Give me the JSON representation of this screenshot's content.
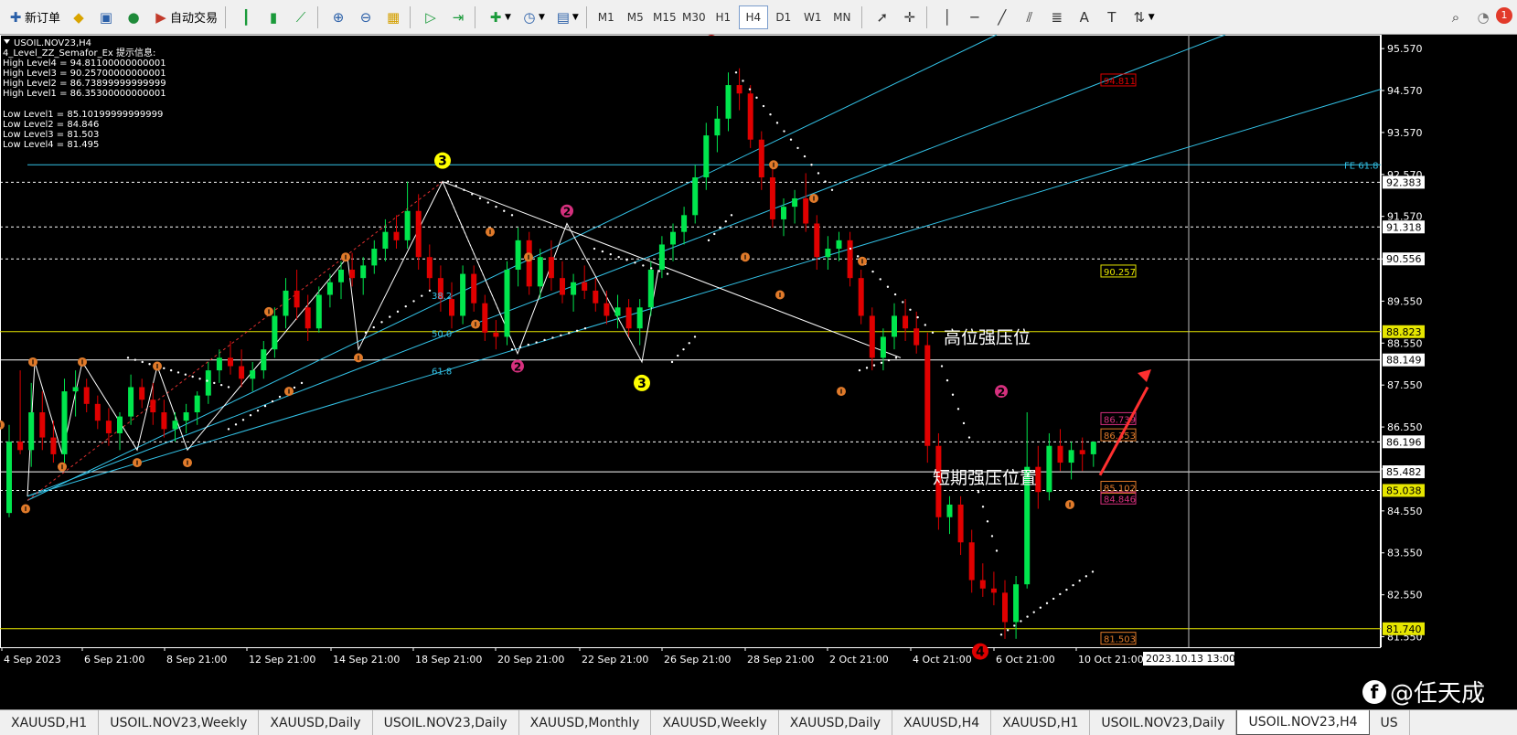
{
  "toolbar": {
    "new_order": "新订单",
    "auto_trading": "自动交易",
    "timeframes": [
      "M1",
      "M5",
      "M15",
      "M30",
      "H1",
      "H4",
      "D1",
      "W1",
      "MN"
    ],
    "active_timeframe": "H4",
    "alert_count": "1"
  },
  "info_panel": {
    "symbol_line": "USOIL.NOV23,H4",
    "indicator_line": "4_Level_ZZ_Semafor_Ex 提示信息:",
    "high_levels": [
      "High Level4 = 94.81100000000001",
      "High Level3 = 90.25700000000001",
      "High Level2 = 86.73899999999999",
      "High Level1 = 86.35300000000001"
    ],
    "low_levels": [
      "Low Level1 = 85.10199999999999",
      "Low Level2 = 84.846",
      "Low Level3 = 81.503",
      "Low Level4 = 81.495"
    ]
  },
  "price_axis": {
    "ticks": [
      "95.570",
      "94.570",
      "93.570",
      "92.570",
      "91.570",
      "90.556",
      "89.550",
      "88.550",
      "87.550",
      "86.550",
      "85.550",
      "84.550",
      "83.550",
      "82.550",
      "81.550"
    ],
    "line_labels": [
      "92.383",
      "91.318",
      "90.556",
      "88.823",
      "88.149",
      "86.196",
      "85.482",
      "85.038",
      "81.740"
    ]
  },
  "time_axis": {
    "ticks": [
      "4 Sep 2023",
      "6 Sep 21:00",
      "8 Sep 21:00",
      "12 Sep 21:00",
      "14 Sep 21:00",
      "18 Sep 21:00",
      "20 Sep 21:00",
      "22 Sep 21:00",
      "26 Sep 21:00",
      "28 Sep 21:00",
      "2 Oct 21:00",
      "4 Oct 21:00",
      "6 Oct 21:00",
      "10 Oct 21:00"
    ],
    "crosshair_time": "2023.10.13 13:00"
  },
  "chart_annotations": {
    "fe_label": "FE 61.8",
    "fib_labels": [
      "38.2",
      "50.0",
      "61.8"
    ],
    "level_boxes": [
      "94.811",
      "90.257",
      "86.739",
      "86.353",
      "85.102",
      "84.846",
      "81.503"
    ],
    "high_resistance": "高位强压位",
    "short_resistance": "短期强压位置"
  },
  "semafor_marks": [
    "4",
    "3",
    "2",
    "2",
    "3",
    "2",
    "4"
  ],
  "tabs": [
    "XAUUSD,H1",
    "USOIL.NOV23,Weekly",
    "XAUUSD,Daily",
    "USOIL.NOV23,Daily",
    "XAUUSD,Monthly",
    "XAUUSD,Weekly",
    "XAUUSD,Daily",
    "XAUUSD,H4",
    "XAUUSD,H1",
    "USOIL.NOV23,Daily",
    "USOIL.NOV23,H4",
    "US"
  ],
  "active_tab": "USOIL.NOV23,H4",
  "watermark": "@任天成",
  "colors": {
    "bull": "#00e64d",
    "bear": "#e00000",
    "axis": "#ffffff",
    "trend": "#33c3e8",
    "level": "#e6e600"
  },
  "chart_data": {
    "type": "candlestick",
    "symbol": "USOIL.NOV23",
    "timeframe": "H4",
    "ylim": [
      81.3,
      95.9
    ],
    "candles": [
      [
        84.5,
        86.6,
        84.4,
        86.2
      ],
      [
        86.2,
        87.9,
        85.9,
        86.0
      ],
      [
        86.0,
        87.6,
        85.6,
        86.9
      ],
      [
        86.9,
        87.4,
        86.0,
        86.3
      ],
      [
        86.3,
        86.7,
        85.7,
        85.9
      ],
      [
        85.9,
        87.7,
        85.7,
        87.4
      ],
      [
        87.4,
        87.9,
        86.8,
        87.5
      ],
      [
        87.5,
        87.7,
        86.9,
        87.1
      ],
      [
        87.1,
        87.3,
        86.5,
        86.7
      ],
      [
        86.7,
        87.0,
        86.1,
        86.4
      ],
      [
        86.4,
        86.9,
        86.0,
        86.8
      ],
      [
        86.8,
        87.8,
        86.6,
        87.5
      ],
      [
        87.5,
        87.7,
        87.0,
        87.2
      ],
      [
        87.2,
        87.6,
        86.6,
        86.9
      ],
      [
        86.9,
        87.2,
        86.3,
        86.5
      ],
      [
        86.5,
        86.9,
        86.2,
        86.7
      ],
      [
        86.7,
        87.1,
        86.4,
        86.9
      ],
      [
        86.9,
        87.4,
        86.6,
        87.3
      ],
      [
        87.3,
        88.1,
        87.1,
        87.9
      ],
      [
        87.9,
        88.4,
        87.6,
        88.2
      ],
      [
        88.2,
        88.6,
        87.8,
        88.0
      ],
      [
        88.0,
        88.4,
        87.5,
        87.7
      ],
      [
        87.7,
        88.1,
        87.4,
        87.9
      ],
      [
        87.9,
        88.6,
        87.7,
        88.4
      ],
      [
        88.4,
        89.4,
        88.2,
        89.2
      ],
      [
        89.2,
        90.1,
        88.9,
        89.8
      ],
      [
        89.8,
        90.3,
        89.1,
        89.4
      ],
      [
        89.4,
        89.7,
        88.6,
        88.9
      ],
      [
        88.9,
        89.9,
        88.8,
        89.7
      ],
      [
        89.7,
        90.2,
        89.4,
        90.0
      ],
      [
        90.0,
        90.5,
        89.6,
        90.3
      ],
      [
        90.3,
        90.7,
        89.9,
        90.1
      ],
      [
        90.1,
        90.6,
        89.7,
        90.4
      ],
      [
        90.4,
        91.0,
        90.2,
        90.8
      ],
      [
        90.8,
        91.5,
        90.5,
        91.2
      ],
      [
        91.2,
        91.6,
        90.8,
        91.0
      ],
      [
        91.0,
        92.4,
        90.8,
        91.7
      ],
      [
        91.7,
        92.1,
        90.3,
        90.6
      ],
      [
        90.6,
        90.9,
        89.8,
        90.1
      ],
      [
        90.1,
        90.4,
        89.3,
        89.6
      ],
      [
        89.6,
        90.0,
        88.9,
        89.2
      ],
      [
        89.2,
        90.4,
        89.0,
        90.2
      ],
      [
        90.2,
        90.4,
        89.3,
        89.5
      ],
      [
        89.5,
        89.7,
        88.6,
        88.8
      ],
      [
        88.8,
        89.1,
        88.4,
        88.7
      ],
      [
        88.7,
        90.5,
        88.5,
        90.3
      ],
      [
        90.3,
        91.3,
        89.9,
        91.0
      ],
      [
        91.0,
        91.2,
        89.7,
        89.9
      ],
      [
        89.9,
        90.8,
        89.6,
        90.6
      ],
      [
        90.6,
        91.0,
        89.8,
        90.1
      ],
      [
        90.1,
        90.5,
        89.5,
        89.7
      ],
      [
        89.7,
        90.2,
        89.3,
        90.0
      ],
      [
        90.0,
        90.4,
        89.6,
        89.8
      ],
      [
        89.8,
        90.1,
        89.3,
        89.5
      ],
      [
        89.5,
        89.8,
        89.0,
        89.2
      ],
      [
        89.2,
        89.7,
        88.9,
        89.4
      ],
      [
        89.4,
        89.6,
        88.7,
        88.9
      ],
      [
        88.9,
        89.6,
        88.5,
        89.4
      ],
      [
        89.4,
        90.5,
        89.2,
        90.3
      ],
      [
        90.3,
        91.1,
        90.1,
        90.9
      ],
      [
        90.9,
        91.4,
        90.5,
        91.2
      ],
      [
        91.2,
        91.8,
        90.9,
        91.6
      ],
      [
        91.6,
        92.8,
        91.4,
        92.5
      ],
      [
        92.5,
        93.8,
        92.2,
        93.5
      ],
      [
        93.5,
        94.2,
        93.1,
        93.9
      ],
      [
        93.9,
        95.0,
        93.6,
        94.7
      ],
      [
        94.7,
        95.1,
        94.1,
        94.5
      ],
      [
        94.5,
        94.7,
        93.2,
        93.4
      ],
      [
        93.4,
        93.6,
        92.2,
        92.5
      ],
      [
        92.5,
        92.7,
        91.3,
        91.5
      ],
      [
        91.5,
        92.0,
        91.1,
        91.8
      ],
      [
        91.8,
        92.2,
        91.4,
        92.0
      ],
      [
        92.0,
        92.6,
        91.2,
        91.4
      ],
      [
        91.4,
        91.6,
        90.3,
        90.6
      ],
      [
        90.6,
        91.1,
        90.3,
        90.8
      ],
      [
        90.8,
        91.2,
        90.5,
        91.0
      ],
      [
        91.0,
        91.2,
        89.9,
        90.1
      ],
      [
        90.1,
        90.3,
        89.0,
        89.2
      ],
      [
        89.2,
        89.4,
        87.9,
        88.2
      ],
      [
        88.2,
        88.9,
        87.9,
        88.7
      ],
      [
        88.7,
        89.5,
        88.4,
        89.2
      ],
      [
        89.2,
        89.6,
        88.6,
        88.9
      ],
      [
        88.9,
        89.3,
        88.3,
        88.5
      ],
      [
        88.5,
        88.8,
        85.7,
        86.1
      ],
      [
        86.1,
        86.4,
        84.1,
        84.4
      ],
      [
        84.4,
        84.9,
        84.0,
        84.7
      ],
      [
        84.7,
        84.9,
        83.5,
        83.8
      ],
      [
        83.8,
        84.1,
        82.6,
        82.9
      ],
      [
        82.9,
        83.3,
        82.5,
        82.7
      ],
      [
        82.7,
        83.1,
        82.3,
        82.6
      ],
      [
        82.6,
        82.9,
        81.5,
        81.9
      ],
      [
        81.9,
        83.0,
        81.5,
        82.8
      ],
      [
        82.8,
        86.9,
        82.7,
        85.6
      ],
      [
        85.6,
        86.1,
        84.6,
        85.0
      ],
      [
        85.0,
        86.4,
        84.8,
        86.1
      ],
      [
        86.1,
        86.5,
        85.5,
        85.7
      ],
      [
        85.7,
        86.2,
        85.3,
        86.0
      ],
      [
        86.0,
        86.3,
        85.5,
        85.9
      ],
      [
        85.9,
        86.1,
        85.6,
        86.2
      ]
    ]
  }
}
